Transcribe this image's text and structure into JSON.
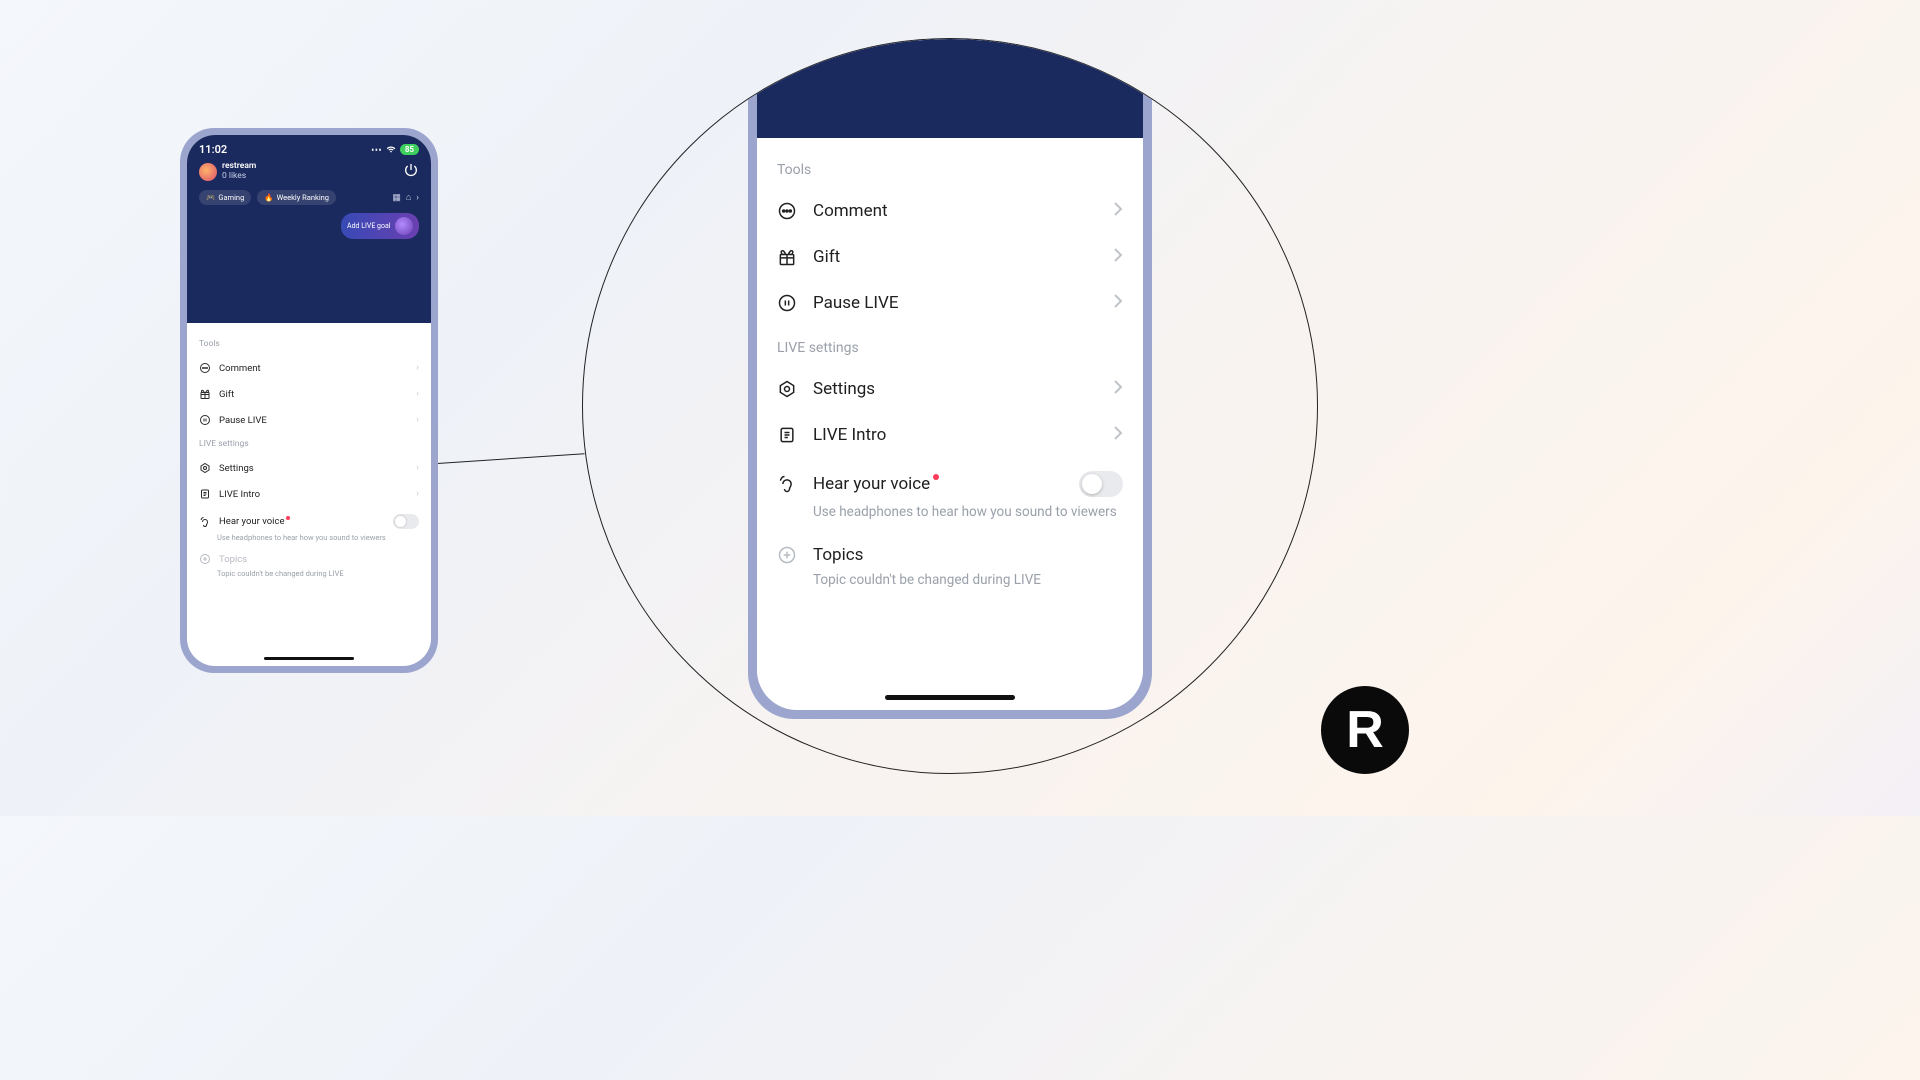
{
  "status": {
    "time": "11:02",
    "battery": "85"
  },
  "profile": {
    "name": "restream",
    "likes": "0 likes"
  },
  "chips": {
    "gaming": "Gaming",
    "ranking": "Weekly Ranking"
  },
  "goal": {
    "label": "Add LIVE goal"
  },
  "sections": {
    "tools": "Tools",
    "live_settings": "LIVE settings"
  },
  "rows": {
    "comment": "Comment",
    "gift": "Gift",
    "pause": "Pause LIVE",
    "settings": "Settings",
    "intro": "LIVE Intro",
    "hear": "Hear your voice",
    "hear_sub": "Use headphones to hear how you sound to viewers",
    "topics": "Topics",
    "topics_sub": "Topic couldn't be changed during LIVE"
  },
  "logo": "R"
}
